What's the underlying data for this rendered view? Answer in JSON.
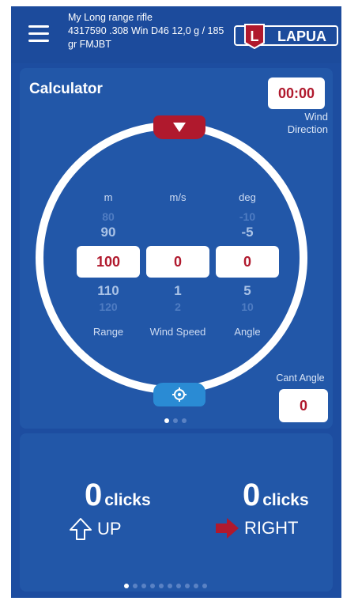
{
  "header": {
    "rifle_name": "My Long range rifle",
    "rifle_details": "4317590 .308 Win  D46 12,0 g / 185 gr  FMJBT",
    "logo_text": "LAPUA",
    "logo_letter": "L"
  },
  "calculator": {
    "title": "Calculator",
    "time": "00:00",
    "wind_direction_label": "Wind Direction",
    "units": {
      "range": "m",
      "wind": "m/s",
      "angle": "deg"
    },
    "range_picker": {
      "above2": "80",
      "above1": "90",
      "value": "100",
      "below1": "110",
      "below2": "120"
    },
    "wind_picker": {
      "above2": "",
      "above1": "",
      "value": "0",
      "below1": "1",
      "below2": "2"
    },
    "angle_picker": {
      "above2": "-10",
      "above1": "-5",
      "value": "0",
      "below1": "5",
      "below2": "10"
    },
    "labels": {
      "range": "Range",
      "wind": "Wind Speed",
      "angle": "Angle"
    },
    "cant_angle_label": "Cant Angle",
    "cant_angle_value": "0",
    "pager": {
      "count": 3,
      "active": 0
    }
  },
  "result": {
    "elevation": {
      "value": "0",
      "unit": "clicks",
      "direction": "UP"
    },
    "windage": {
      "value": "0",
      "unit": "clicks",
      "direction": "RIGHT"
    },
    "pager": {
      "count": 10,
      "active": 0
    }
  },
  "colors": {
    "brand_red": "#b0192d",
    "card_blue": "#2257a8",
    "accent_blue": "#2a8bd4"
  }
}
